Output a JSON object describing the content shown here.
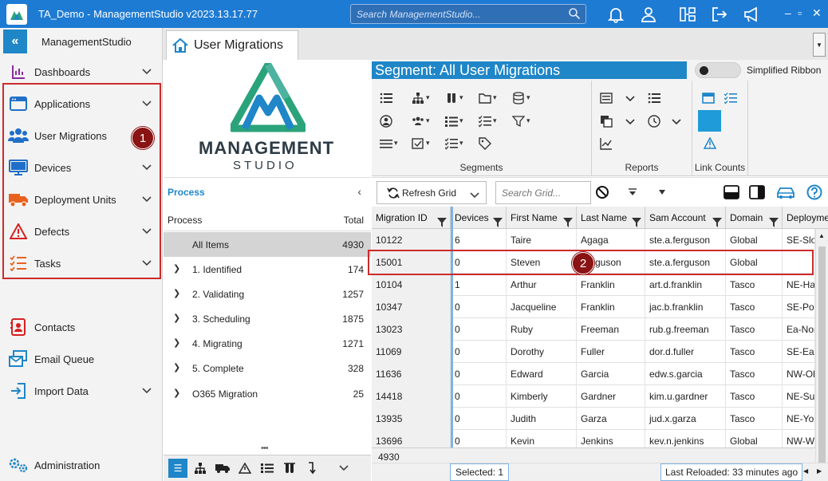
{
  "window": {
    "title": "TA_Demo - ManagementStudio v2023.13.17.77",
    "search_placeholder": "Search ManagementStudio...",
    "minimize": "–",
    "maximize": "▫",
    "close": "✕"
  },
  "sidebar": {
    "title": "ManagementStudio",
    "collapse_label": "«",
    "items": [
      {
        "label": "Dashboards",
        "icon": "dashboard-icon",
        "chevron": true
      },
      {
        "label": "Applications",
        "icon": "applications-icon",
        "chevron": true
      },
      {
        "label": "User Migrations",
        "icon": "users-icon",
        "chevron": false
      },
      {
        "label": "Devices",
        "icon": "monitor-icon",
        "chevron": true
      },
      {
        "label": "Deployment Units",
        "icon": "truck-icon",
        "chevron": true
      },
      {
        "label": "Defects",
        "icon": "warning-icon",
        "chevron": true
      },
      {
        "label": "Tasks",
        "icon": "tasks-icon",
        "chevron": true
      },
      {
        "label": "Contacts",
        "icon": "contacts-icon",
        "chevron": false
      },
      {
        "label": "Email Queue",
        "icon": "email-icon",
        "chevron": false
      },
      {
        "label": "Import Data",
        "icon": "import-icon",
        "chevron": true
      },
      {
        "label": "Administration",
        "icon": "gears-icon",
        "chevron": false
      }
    ]
  },
  "annotations": {
    "badge1": "1",
    "badge2": "2"
  },
  "tab": {
    "label": "User Migrations"
  },
  "logo": {
    "line1": "MANAGEMENT",
    "line2": "STUDIO"
  },
  "process": {
    "header": "Process",
    "col_process": "Process",
    "col_total": "Total",
    "rows": [
      {
        "name": "All Items",
        "total": "4930",
        "selected": true,
        "expandable": false
      },
      {
        "name": "1. Identified",
        "total": "174",
        "expandable": true
      },
      {
        "name": "2. Validating",
        "total": "1257",
        "expandable": true
      },
      {
        "name": "3. Scheduling",
        "total": "1875",
        "expandable": true
      },
      {
        "name": "4. Migrating",
        "total": "1271",
        "expandable": true
      },
      {
        "name": "5. Complete",
        "total": "328",
        "expandable": true
      },
      {
        "name": "O365 Migration",
        "total": "25",
        "expandable": true
      }
    ]
  },
  "ribbon": {
    "segment_title": "Segment: All User Migrations",
    "simplified_label": "Simplified Ribbon",
    "groups": {
      "segments": "Segments",
      "reports": "Reports",
      "link_counts": "Link Counts"
    }
  },
  "grid_toolbar": {
    "refresh_label": "Refresh Grid",
    "search_placeholder": "Search Grid..."
  },
  "grid": {
    "columns": [
      "Migration ID",
      "Devices",
      "First Name",
      "Last Name",
      "Sam Account",
      "Domain",
      "Deployme"
    ],
    "rows": [
      [
        "10122",
        "6",
        "Taire",
        "Agaga",
        "ste.a.ferguson",
        "Global",
        "SE-Slou"
      ],
      [
        "15001",
        "0",
        "Steven",
        "Ferguson",
        "ste.a.ferguson",
        "Global",
        ""
      ],
      [
        "10104",
        "1",
        "Arthur",
        "Franklin",
        "art.d.franklin",
        "Tasco",
        "NE-Har"
      ],
      [
        "10347",
        "0",
        "Jacqueline",
        "Franklin",
        "jac.b.franklin",
        "Tasco",
        "SE-Port"
      ],
      [
        "13023",
        "0",
        "Ruby",
        "Freeman",
        "rub.g.freeman",
        "Tasco",
        "Ea-Nor"
      ],
      [
        "11069",
        "0",
        "Dorothy",
        "Fuller",
        "dor.d.fuller",
        "Tasco",
        "SE-East"
      ],
      [
        "11636",
        "0",
        "Edward",
        "Garcia",
        "edw.s.garcia",
        "Tasco",
        "NW-Ol"
      ],
      [
        "14418",
        "0",
        "Kimberly",
        "Gardner",
        "kim.u.gardner",
        "Tasco",
        "NE-Sur"
      ],
      [
        "13935",
        "0",
        "Judith",
        "Garza",
        "jud.x.garza",
        "Tasco",
        "NE-Yor"
      ],
      [
        "13696",
        "0",
        "Kevin",
        "Jenkins",
        "kev.n.jenkins",
        "Global",
        "NW-W"
      ]
    ],
    "footer_count": "4930",
    "selected_text": "Selected: 1",
    "reloaded_text": "Last Reloaded: 33 minutes ago"
  }
}
